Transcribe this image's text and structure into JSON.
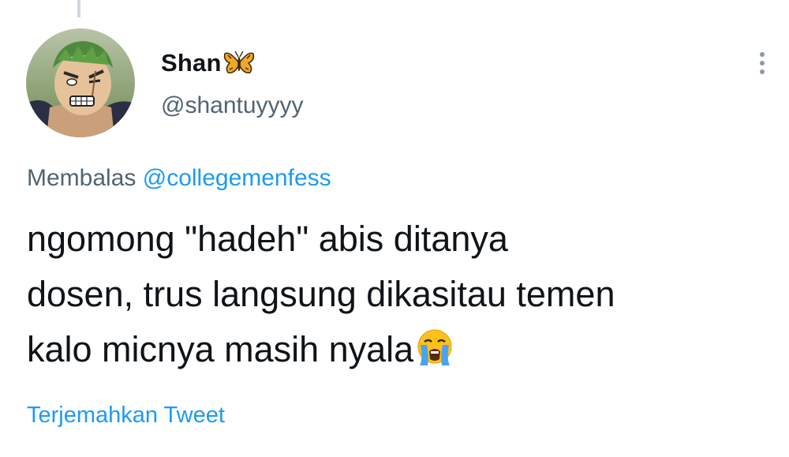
{
  "tweet": {
    "author": {
      "display_name": "Shan",
      "handle": "@shantuyyyy",
      "avatar_icon": "anime-character-avatar",
      "name_emoji": "butterfly-emoji"
    },
    "replying_to": {
      "prefix": "Membalas",
      "mention": "@collegemenfess"
    },
    "text_lines": [
      "ngomong \"hadeh\" abis ditanya",
      "dosen, trus langsung dikasitau temen",
      "kalo micnya masih nyala"
    ],
    "text_emoji": "loudly-crying-face-emoji",
    "translate_label": "Terjemahkan Tweet"
  },
  "colors": {
    "text_primary": "#0f1419",
    "text_secondary": "#536471",
    "link": "#1d9bf0"
  }
}
